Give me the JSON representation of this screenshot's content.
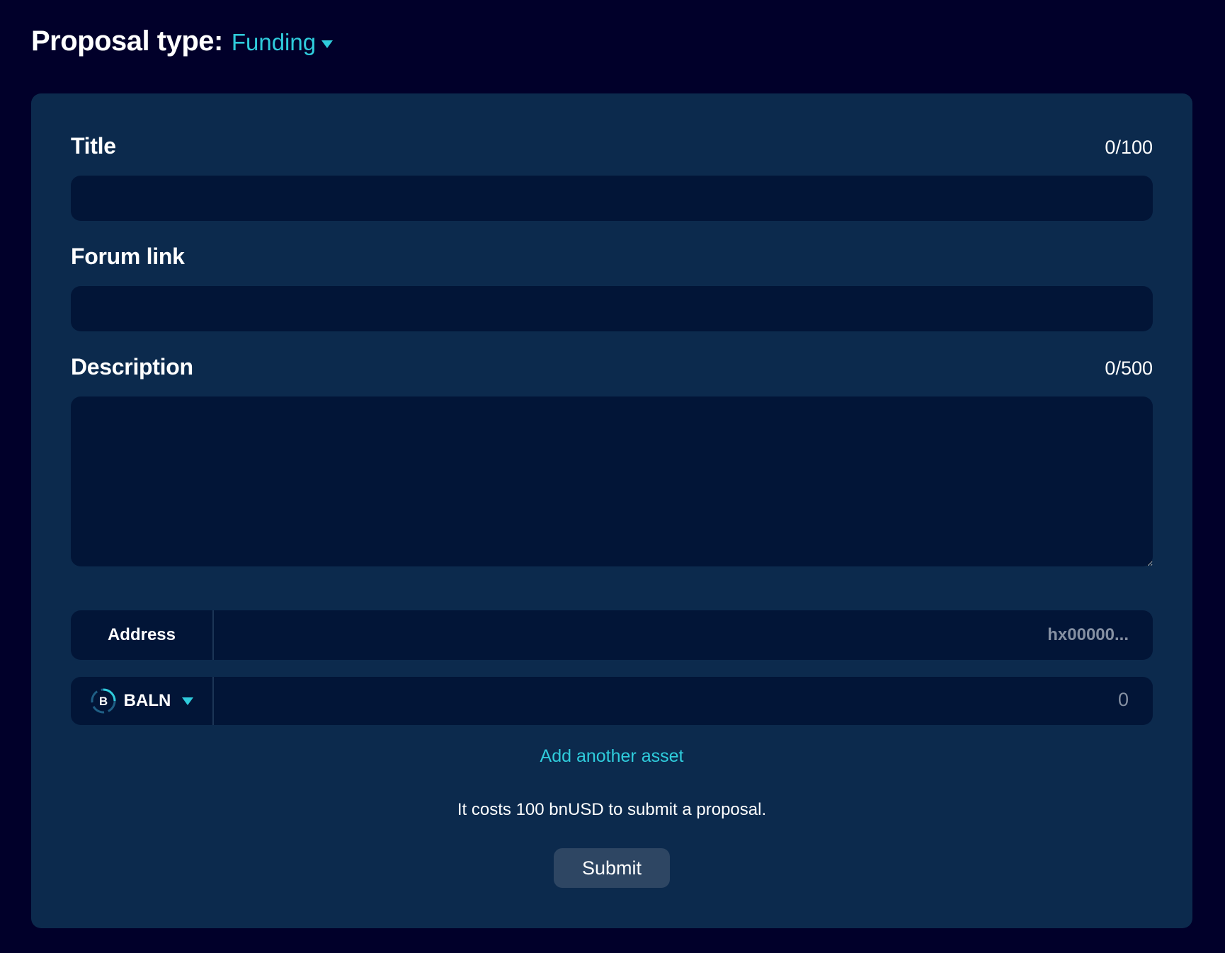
{
  "header": {
    "title": "Proposal type:",
    "type_value": "Funding"
  },
  "form": {
    "title": {
      "label": "Title",
      "counter": "0/100",
      "value": ""
    },
    "forum_link": {
      "label": "Forum link",
      "value": ""
    },
    "description": {
      "label": "Description",
      "counter": "0/500",
      "value": ""
    },
    "address": {
      "label": "Address",
      "placeholder": "hx00000..."
    },
    "asset": {
      "token": "BALN",
      "token_icon_letter": "B",
      "placeholder": "0"
    },
    "add_asset_label": "Add another asset",
    "cost_note": "It costs 100 bnUSD to submit a proposal.",
    "submit_label": "Submit"
  },
  "colors": {
    "background": "#01002a",
    "card": "#0c2a4d",
    "input": "#021537",
    "accent": "#2fccdc",
    "button": "#2e4663"
  },
  "icons": {
    "type_caret": "caret-down-icon",
    "token": "baln-token-icon",
    "token_caret": "caret-down-icon"
  }
}
